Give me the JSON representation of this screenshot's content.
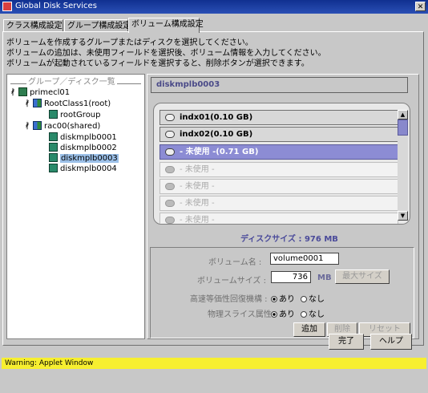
{
  "window": {
    "title": "Global Disk Services",
    "close_label": "✕"
  },
  "tabs": [
    {
      "label": "クラス構成設定"
    },
    {
      "label": "グループ構成設定"
    },
    {
      "label": "ボリューム構成設定",
      "active": true
    }
  ],
  "instructions": [
    "ボリュームを作成するグループまたはディスクを選択してください。",
    "ボリュームの追加は、未使用フィールドを選択後、ボリューム情報を入力してください。",
    "ボリュームが起動されているフィールドを選択すると、削除ボタンが選択できます。"
  ],
  "tree": {
    "header": "グループ／ディスク一覧",
    "nodes": [
      {
        "label": "primecl01",
        "type": "host",
        "expanded": true
      },
      {
        "label": "RootClass1(root)",
        "type": "class",
        "expanded": true
      },
      {
        "label": "rootGroup",
        "type": "disk"
      },
      {
        "label": "rac00(shared)",
        "type": "class",
        "expanded": true
      },
      {
        "label": "diskmplb0001",
        "type": "disk"
      },
      {
        "label": "diskmplb0002",
        "type": "disk"
      },
      {
        "label": "diskmplb0003",
        "type": "disk",
        "selected": true
      },
      {
        "label": "diskmplb0004",
        "type": "disk"
      }
    ]
  },
  "selected_disk": "diskmplb0003",
  "volumes": [
    {
      "label": "indx01(0.10 GB)",
      "state": "used"
    },
    {
      "label": "indx02(0.10 GB)",
      "state": "used"
    },
    {
      "label": "- 未使用 -(0.71 GB)",
      "state": "selected"
    },
    {
      "label": "- 未使用 -",
      "state": "free"
    },
    {
      "label": "- 未使用 -",
      "state": "free"
    },
    {
      "label": "- 未使用 -",
      "state": "free"
    },
    {
      "label": "- 未使用 -",
      "state": "free"
    }
  ],
  "disk_size": "ディスクサイズ : 976 MB",
  "form": {
    "volume_name_label": "ボリューム名 :",
    "volume_name_value": "volume0001",
    "volume_size_label": "ボリュームサイズ :",
    "volume_size_value": "736",
    "size_unit": "MB",
    "max_size_button": "最大サイズ",
    "fast_resync_label": "高速等価性回復機構 :",
    "physical_slice_label": "物理スライス属性 :",
    "yes_label": "あり",
    "no_label": "なし",
    "add_button": "追加",
    "delete_button": "削除",
    "reset_button": "リセット"
  },
  "footer": {
    "finish_button": "完了",
    "help_button": "ヘルプ"
  },
  "status": "Warning: Applet Window"
}
